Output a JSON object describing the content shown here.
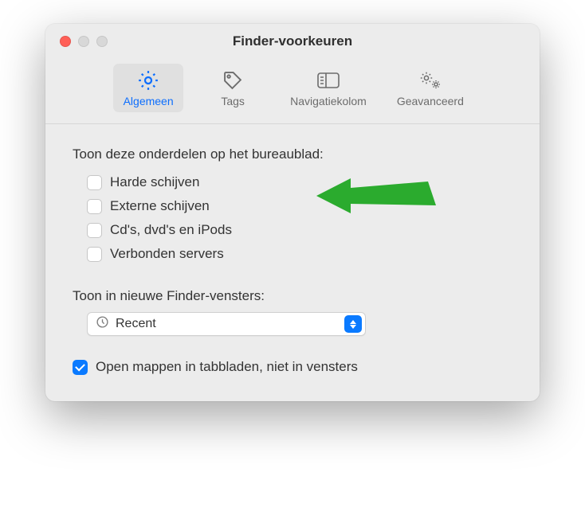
{
  "window": {
    "title": "Finder-voorkeuren"
  },
  "toolbar": {
    "items": [
      {
        "label": "Algemeen",
        "icon": "gear-icon",
        "selected": true
      },
      {
        "label": "Tags",
        "icon": "tag-icon",
        "selected": false
      },
      {
        "label": "Navigatiekolom",
        "icon": "sidebar-icon",
        "selected": false
      },
      {
        "label": "Geavanceerd",
        "icon": "gears-icon",
        "selected": false
      }
    ]
  },
  "desktopSection": {
    "heading": "Toon deze onderdelen op het bureaublad:",
    "items": [
      {
        "label": "Harde schijven",
        "checked": false
      },
      {
        "label": "Externe schijven",
        "checked": false
      },
      {
        "label": "Cd's, dvd's en iPods",
        "checked": false
      },
      {
        "label": "Verbonden servers",
        "checked": false
      }
    ]
  },
  "newWindowSection": {
    "heading": "Toon in nieuwe Finder-vensters:",
    "selected": "Recent"
  },
  "openInTabs": {
    "label": "Open mappen in tabbladen, niet in vensters",
    "checked": true
  },
  "annotation": {
    "arrow_color": "#2bab2e"
  }
}
